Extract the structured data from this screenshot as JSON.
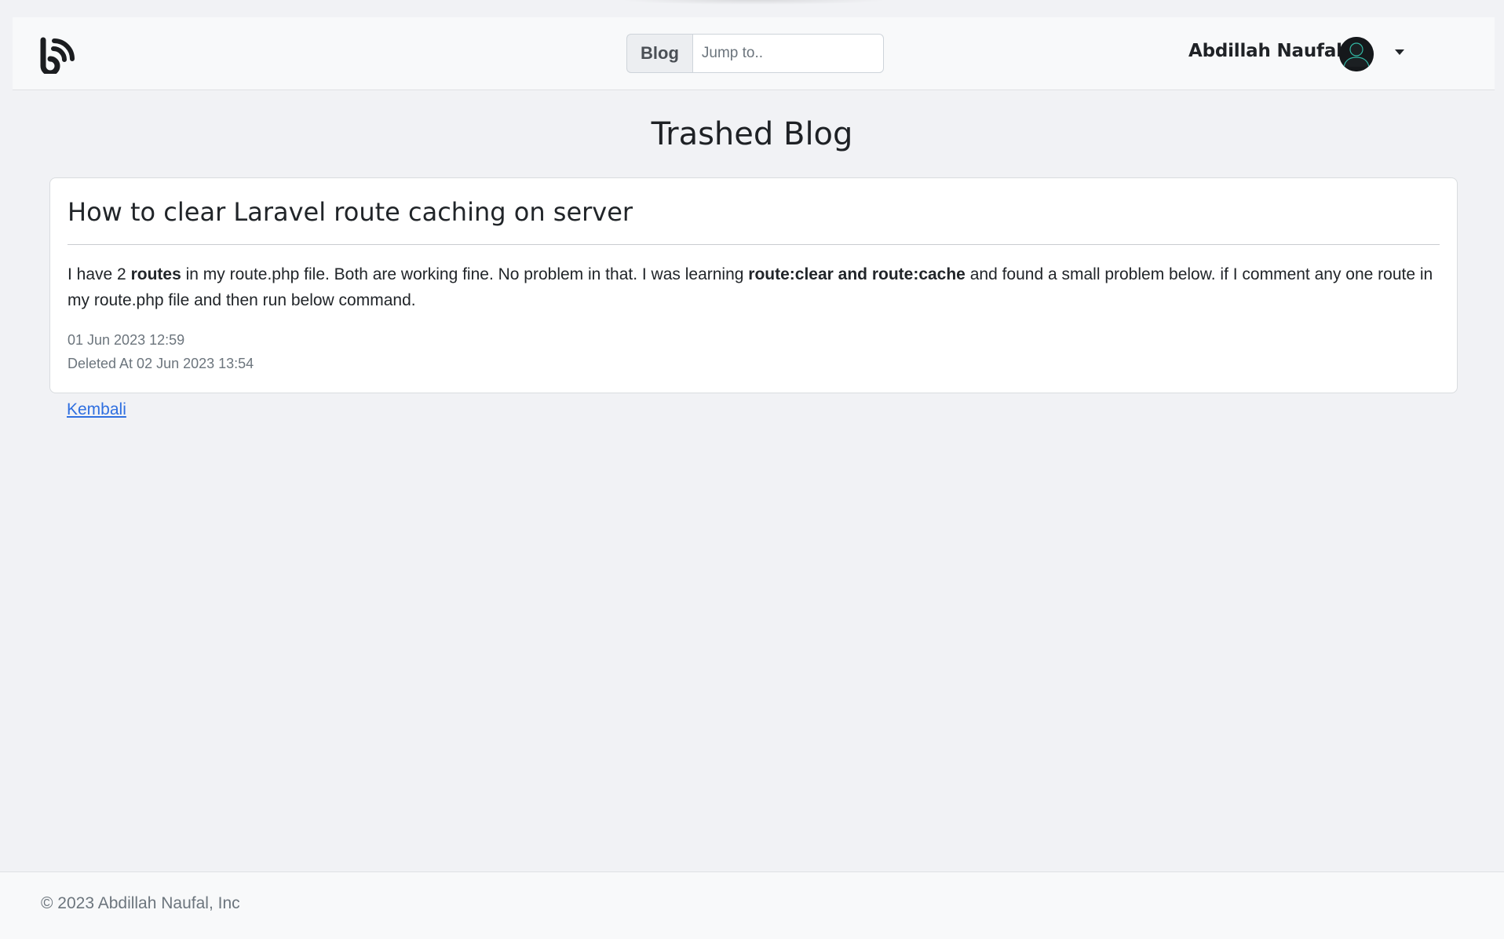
{
  "navbar": {
    "search": {
      "button_label": "Blog",
      "placeholder": "Jump to.."
    },
    "user": {
      "name": "Abdillah Naufal"
    }
  },
  "page": {
    "title": "Trashed Blog"
  },
  "post": {
    "title": "How to clear Laravel route caching on server",
    "body": {
      "p1": "I have 2 ",
      "b1": "routes",
      "p2": " in my route.php file. Both are working fine. No problem in that. I was learning ",
      "b2": "route:clear and route:cache",
      "p3": " and found a small problem below. if I comment any one route in my route.php file and then run below command."
    },
    "date": "01 Jun 2023 12:59",
    "deleted": "Deleted At 02 Jun 2023 13:54"
  },
  "back_link": "Kembali",
  "footer": {
    "copyright": "© 2023 Abdillah Naufal, Inc"
  },
  "colors": {
    "background": "#f1f2f5",
    "link": "#2f6fe0",
    "muted": "#6c757d"
  },
  "icons": [
    "blog-logo-icon",
    "user-avatar-icon",
    "caret-down-icon"
  ]
}
